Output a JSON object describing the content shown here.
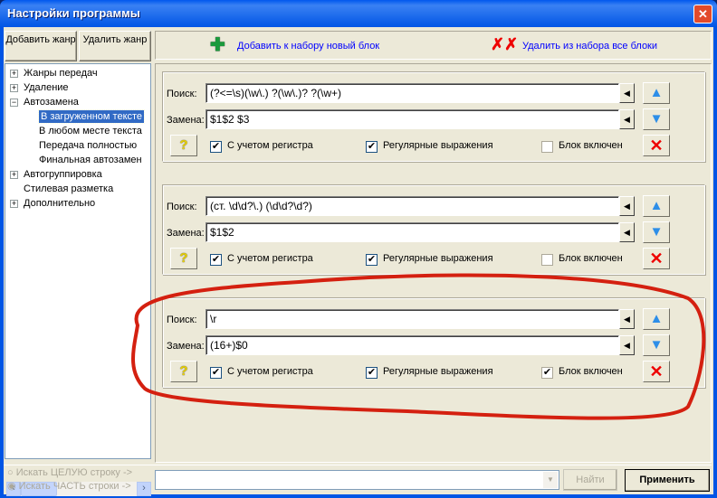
{
  "window": {
    "title": "Настройки программы",
    "close": "✕"
  },
  "left": {
    "add_genre": "Добавить жанр",
    "delete_genre": "Удалить жанр",
    "tree": [
      {
        "label": "Жанры передач",
        "level": 0,
        "expander": "+"
      },
      {
        "label": "Удаление",
        "level": 0,
        "expander": "+"
      },
      {
        "label": "Автозамена",
        "level": 0,
        "expander": "−"
      },
      {
        "label": "В загруженном тексте",
        "level": 1,
        "selected": true
      },
      {
        "label": "В любом месте текста",
        "level": 1
      },
      {
        "label": "Передача полностью",
        "level": 1
      },
      {
        "label": "Финальная автозамен",
        "level": 1
      },
      {
        "label": "Автогруппировка",
        "level": 0,
        "expander": "+"
      },
      {
        "label": "Стилевая разметка",
        "level": 0
      },
      {
        "label": "Дополнительно",
        "level": 0,
        "expander": "+"
      }
    ]
  },
  "toolbar": {
    "add_block": "Добавить к набору новый блок",
    "remove_all": "Удалить из набора все блоки"
  },
  "labels": {
    "search": "Поиск:",
    "replace": "Замена:",
    "case": "С учетом регистра",
    "regex": "Регулярные выражения",
    "enabled": "Блок включен",
    "help": "?"
  },
  "blocks": [
    {
      "search": "(?<=\\s)(\\w\\.) ?(\\w\\.)? ?(\\w+)",
      "replace": "$1$2 $3",
      "case": true,
      "regex": true,
      "enabled": false
    },
    {
      "search": "(ст. \\d\\d?\\.) (\\d\\d?\\d?)",
      "replace": "$1$2",
      "case": true,
      "regex": true,
      "enabled": false
    },
    {
      "search": "\\r",
      "replace": "(16+)$0",
      "case": true,
      "regex": true,
      "enabled": true
    }
  ],
  "bottom": {
    "whole": "Искать ЦЕЛУЮ строку ->",
    "part": "Искать ЧАСТЬ строки ->",
    "find_value": "",
    "find": "Найти",
    "apply": "Применить"
  },
  "colors": {
    "annotation": "#d42010",
    "selection": "#316ac5"
  }
}
